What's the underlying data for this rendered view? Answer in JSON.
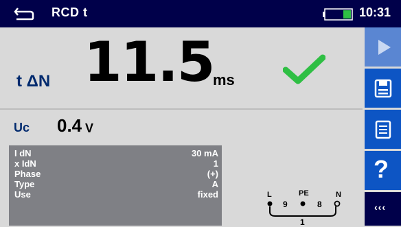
{
  "header": {
    "title": "RCD t",
    "time": "10:31",
    "back_icon": "back-arrow-icon",
    "battery_icon": "battery-icon"
  },
  "result": {
    "tdn_label": "t ΔN",
    "tdn_value": "11.5",
    "tdn_unit": "ms",
    "status_icon": "checkmark-icon",
    "status_color": "#2fbf44",
    "uc_label": "Uc",
    "uc_value": "0.4",
    "uc_unit": "V"
  },
  "parameters": [
    {
      "name": "I dN",
      "value": "30 mA"
    },
    {
      "name": "x IdN",
      "value": "1"
    },
    {
      "name": "Phase",
      "value": "(+)"
    },
    {
      "name": "Type",
      "value": "A"
    },
    {
      "name": "Use",
      "value": "fixed"
    }
  ],
  "terminals": {
    "left": "L",
    "middle": "PE",
    "right": "N",
    "num_left": "9",
    "num_right": "8",
    "bottom": "1"
  },
  "sidebar": {
    "start_icon": "play-icon",
    "save_icon": "save-icon",
    "list_icon": "list-icon",
    "help_label": "?",
    "more_label": "‹‹‹"
  },
  "colors": {
    "header_bg": "#00004a",
    "accent_blue": "#0d55c4",
    "label_blue": "#002a6e",
    "panel_gray": "#7f8085"
  }
}
